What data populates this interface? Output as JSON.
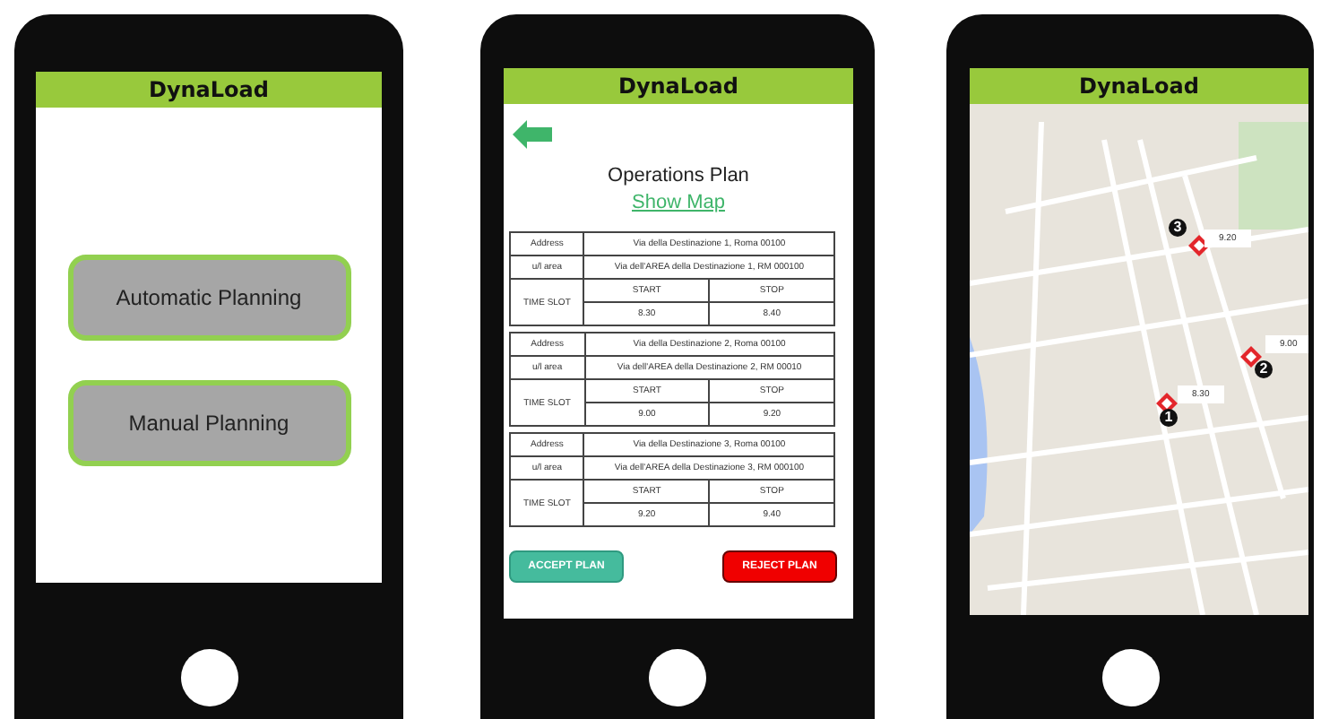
{
  "menu_screen": {
    "header": "DynaLoad",
    "buttons": [
      "Automatic Planning",
      "Manual Planning"
    ]
  },
  "plan_screen": {
    "header": "DynaLoad",
    "title": "Operations Plan",
    "link": "Show Map",
    "stops": [
      {
        "address_label": "Address",
        "address": "Via della Destinazione 1, Roma 00100",
        "area_label": "u/l area",
        "area": "Via dell'AREA della Destinazione 1, RM 000100",
        "slot_label": "TIME SLOT",
        "start_label": "START",
        "stop_label": "STOP",
        "start": "8.30",
        "stop": "8.40"
      },
      {
        "address_label": "Address",
        "address": "Via della Destinazione 2, Roma 00100",
        "area_label": "u/l area",
        "area": "Via dell'AREA della Destinazione 2, RM 00010",
        "slot_label": "TIME SLOT",
        "start_label": "START",
        "stop_label": "STOP",
        "start": "9.00",
        "stop": "9.20"
      },
      {
        "address_label": "Address",
        "address": "Via della Destinazione 3, Roma 00100",
        "area_label": "u/l area",
        "area": "Via dell'AREA della Destinazione 3, RM 000100",
        "slot_label": "TIME SLOT",
        "start_label": "START",
        "stop_label": "STOP",
        "start": "9.20",
        "stop": "9.40"
      }
    ],
    "accept_button": "ACCEPT PLAN",
    "reject_button": "REJECT PLAN"
  },
  "map_screen": {
    "header": "DynaLoad",
    "pins": [
      {
        "number": "3",
        "time": "9.20"
      },
      {
        "number": "2",
        "time": "9.00"
      },
      {
        "number": "1",
        "time": "8.30"
      }
    ]
  }
}
